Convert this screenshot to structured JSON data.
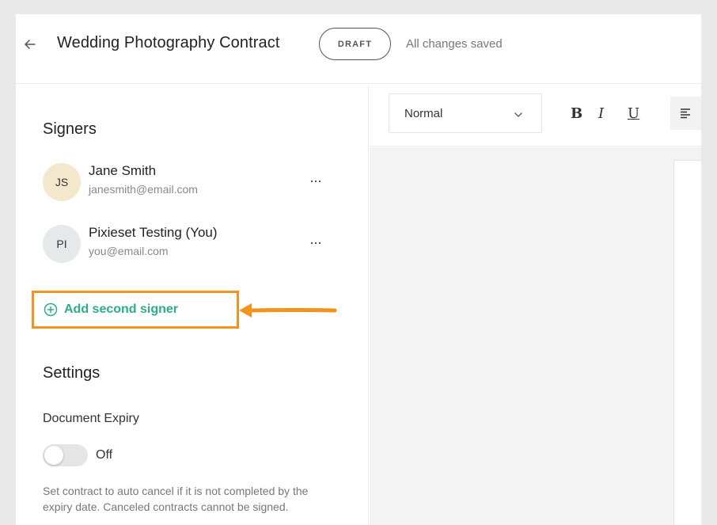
{
  "header": {
    "title": "Wedding Photography Contract",
    "status_badge": "DRAFT",
    "save_status": "All changes saved"
  },
  "sidebar": {
    "signers_heading": "Signers",
    "signers": [
      {
        "initials": "JS",
        "name": "Jane Smith",
        "email": "janesmith@email.com",
        "avatar_color": "#f3e8cc",
        "more": "···"
      },
      {
        "initials": "PI",
        "name": "Pixieset Testing (You)",
        "email": "you@email.com",
        "avatar_color": "#e6e9ea",
        "more": "···"
      }
    ],
    "add_signer_label": "Add second signer",
    "settings_heading": "Settings",
    "expiry_label": "Document Expiry",
    "expiry_state": "Off",
    "expiry_help": "Set contract to auto cancel if it is not completed by the expiry date. Canceled contracts cannot be signed."
  },
  "editor": {
    "style_value": "Normal",
    "bold": "B",
    "italic": "I",
    "underline": "U"
  },
  "colors": {
    "accent": "#2aae8c",
    "highlight": "#f2931f"
  },
  "icons": [
    "back-arrow-icon",
    "more-icon",
    "add-circle-icon",
    "chevron-down-icon",
    "align-left-icon"
  ]
}
